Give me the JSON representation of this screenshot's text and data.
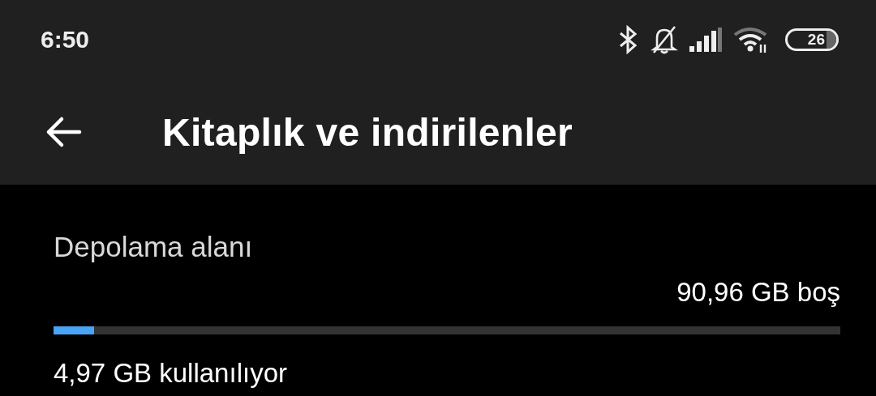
{
  "status_bar": {
    "time": "6:50",
    "battery": "26"
  },
  "header": {
    "title": "Kitaplık ve indirilenler"
  },
  "storage": {
    "title": "Depolama alanı",
    "free": "90,96 GB boş",
    "level": 0.052,
    "used": "4,97 GB kullanılıyor"
  }
}
